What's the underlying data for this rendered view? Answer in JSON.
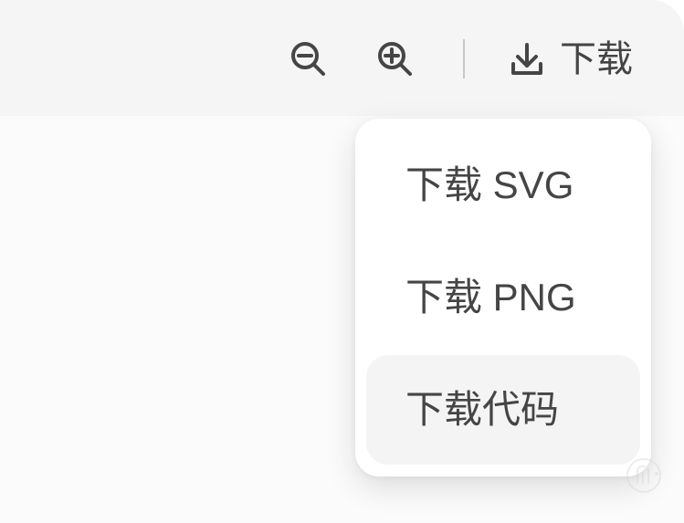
{
  "toolbar": {
    "zoom_out_icon": "zoom-out-icon",
    "zoom_in_icon": "zoom-in-icon",
    "download_icon": "download-icon",
    "download_label": "下载"
  },
  "menu": {
    "items": [
      {
        "label": "下载 SVG"
      },
      {
        "label": "下载 PNG"
      },
      {
        "label": "下载代码"
      }
    ]
  },
  "colors": {
    "background": "#fbfbfb",
    "toolbar": "#f5f5f5",
    "text": "#444444",
    "divider": "#c9c9c9",
    "menu": "#ffffff",
    "menu_hover": "#f4f4f4"
  }
}
